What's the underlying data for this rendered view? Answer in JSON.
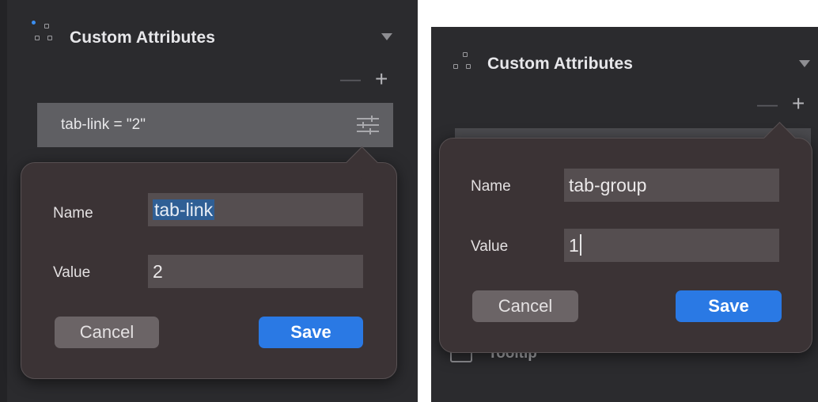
{
  "left": {
    "section_title": "Custom Attributes",
    "minus_label": "—",
    "plus_label": "+",
    "attribute_row": "tab-link = \"2\"",
    "popover": {
      "name_label": "Name",
      "name_value": "tab-link",
      "value_label": "Value",
      "value_value": "2",
      "cancel_label": "Cancel",
      "save_label": "Save"
    }
  },
  "right": {
    "section_title": "Custom Attributes",
    "minus_label": "—",
    "plus_label": "+",
    "popover": {
      "name_label": "Name",
      "name_value": "tab-group",
      "value_label": "Value",
      "value_value": "1",
      "cancel_label": "Cancel",
      "save_label": "Save"
    },
    "behind_row_label": "Tooltip"
  },
  "colors": {
    "panel_bg": "#2b2b2e",
    "popover_bg": "#3b3335",
    "save_blue": "#2a79e4",
    "selection": "#2f5f95"
  },
  "icons": [
    "custom-attributes-icon",
    "collapse-caret-icon",
    "edit-attribute-icon",
    "tooltip-icon"
  ]
}
